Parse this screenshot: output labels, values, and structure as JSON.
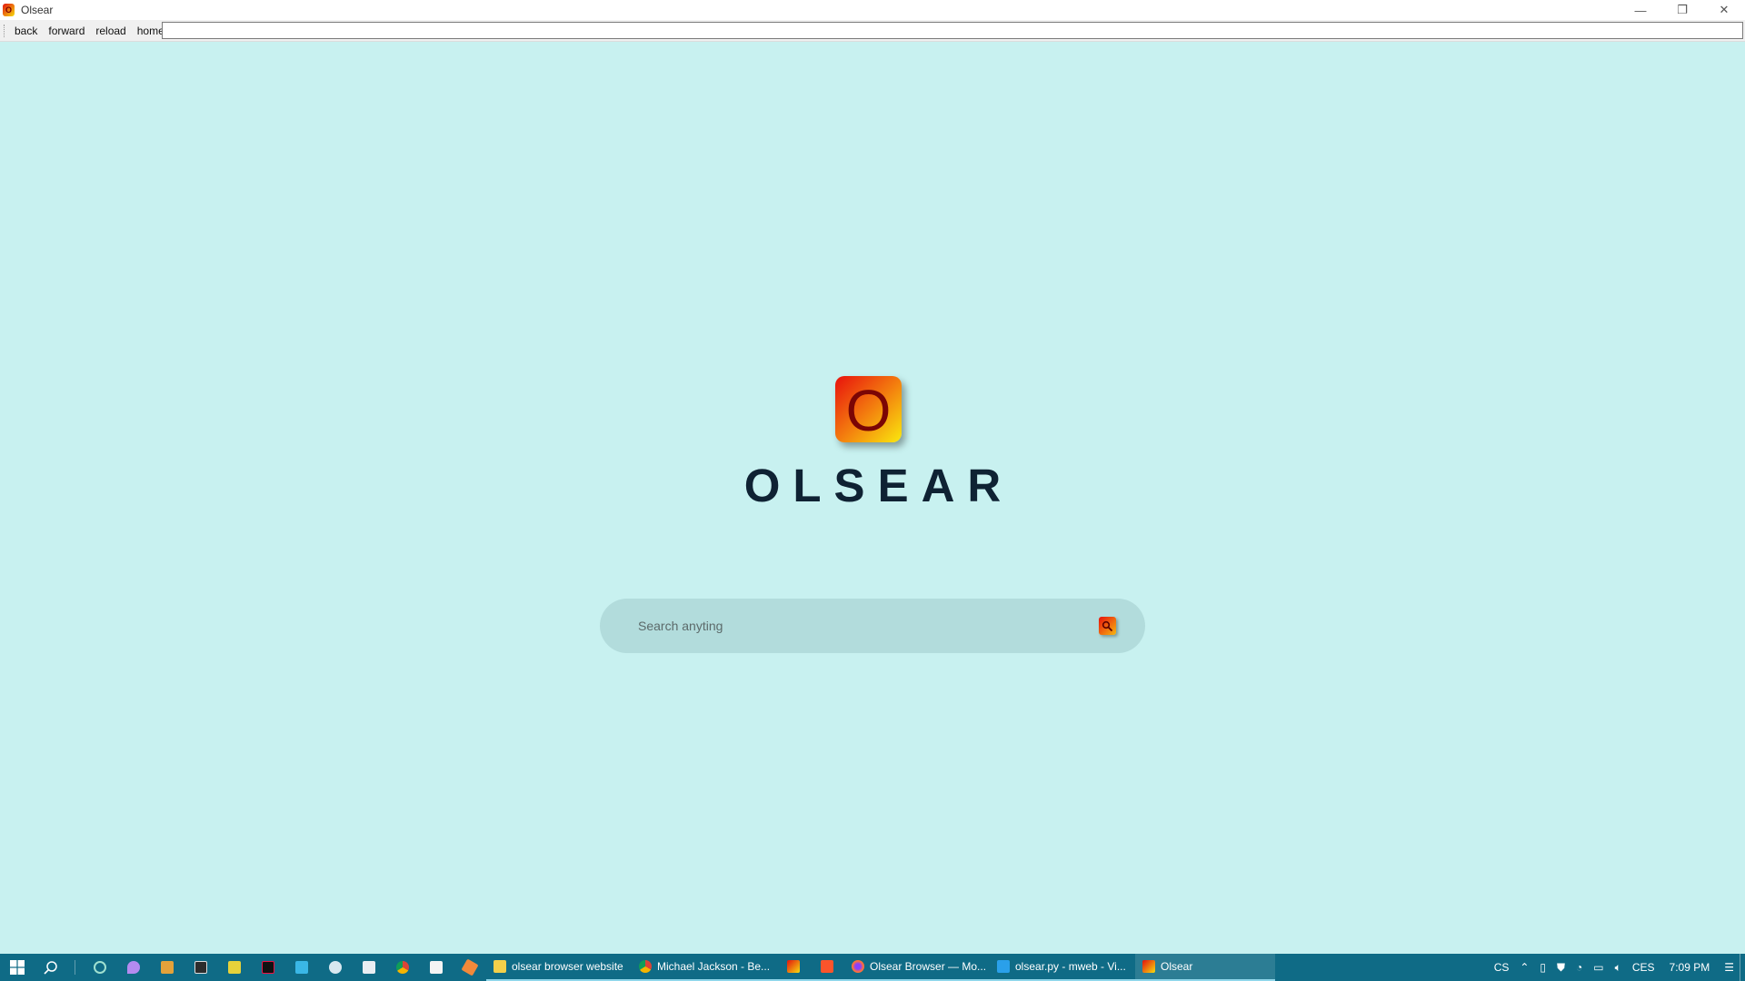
{
  "window": {
    "title": "Olsear",
    "app_icon_letter": "O",
    "controls": {
      "minimize": "—",
      "restore": "❐",
      "close": "✕"
    }
  },
  "toolbar": {
    "back": "back",
    "forward": "forward",
    "reload": "reload",
    "home": "home",
    "url_value": ""
  },
  "page": {
    "logo_letter": "O",
    "brand": "OLSEAR",
    "search": {
      "placeholder": "Search anyting",
      "value": ""
    }
  },
  "taskbar": {
    "tasks": [
      {
        "label": "olsear browser website",
        "icon": "folder-icon",
        "color": "#f3d04a"
      },
      {
        "label": "Michael Jackson - Be...",
        "icon": "chrome-icon",
        "color": "#4caf50"
      },
      {
        "label": "",
        "icon": "olsear-icon",
        "color": "#f07a0e"
      },
      {
        "label": "",
        "icon": "brave-icon",
        "color": "#fb542b"
      },
      {
        "label": "Olsear Browser — Mo...",
        "icon": "firefox-icon",
        "color": "#ff7139"
      },
      {
        "label": "olsear.py - mweb - Vi...",
        "icon": "vscode-icon",
        "color": "#2aa0ea"
      },
      {
        "label": "Olsear",
        "icon": "olsear-icon",
        "color": "#f07a0e"
      }
    ],
    "tray": {
      "lang_short": "CS",
      "lang": "CES",
      "time": "7:09 PM"
    }
  }
}
